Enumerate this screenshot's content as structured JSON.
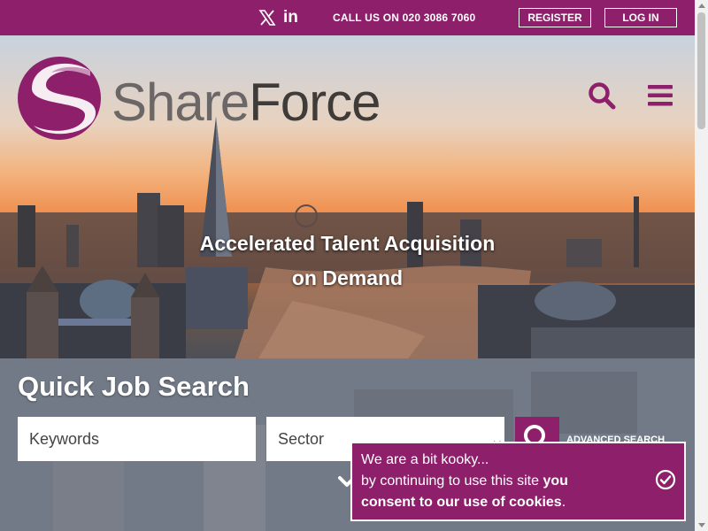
{
  "topbar": {
    "call_text": "CALL US ON 020 3086 7060",
    "register_label": "REGISTER",
    "login_label": "LOG IN",
    "social": [
      "x-icon",
      "linkedin-icon"
    ],
    "linkedin_text": "in"
  },
  "brand": {
    "name_part1": "Share",
    "name_part2": "Force",
    "color": "#8e1f6b"
  },
  "hero": {
    "headline_line1": "Accelerated Talent Acquisition",
    "headline_line2": "on Demand"
  },
  "search": {
    "title": "Quick Job Search",
    "keywords_placeholder": "Keywords",
    "sector_selected": "Sector",
    "advanced_label": "ADVANCED SEARCH"
  },
  "cookie": {
    "line1": "We are a bit kooky...",
    "line2_plain": "by continuing to use this site ",
    "line2_bold": "you",
    "line3_bold": "consent to our use of cookies",
    "line3_end": "."
  },
  "icons": [
    "x-icon",
    "linkedin-icon",
    "logo-swirl",
    "search-icon",
    "menu-icon",
    "magnifier-icon",
    "chevron-down-icon",
    "check-circle-icon"
  ]
}
